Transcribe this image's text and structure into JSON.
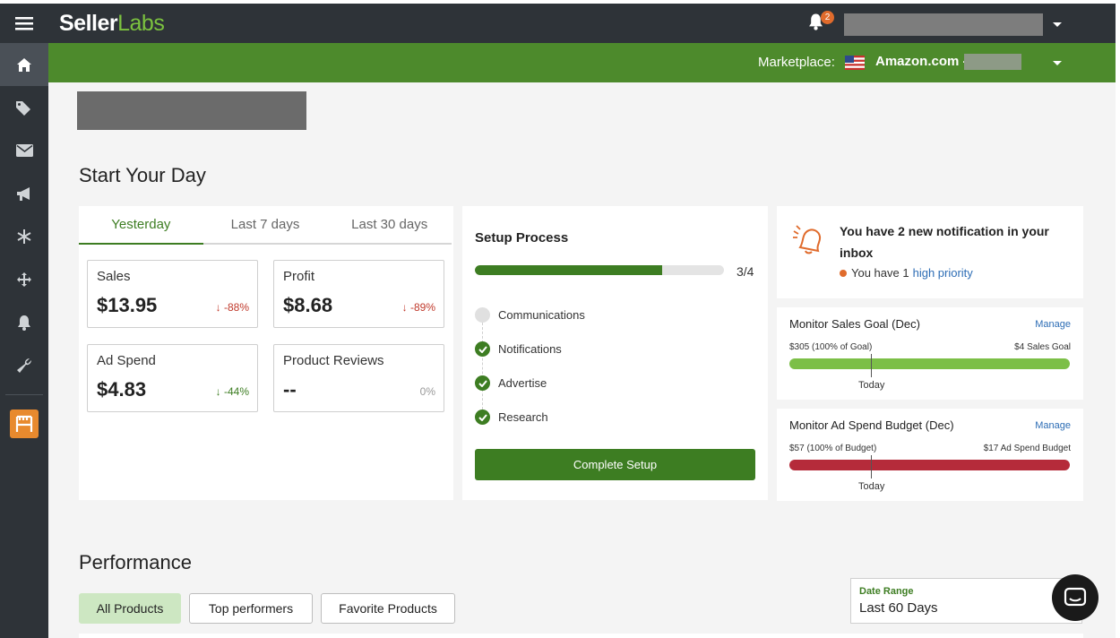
{
  "brand": {
    "name_part1": "Seller",
    "name_part2": "Labs"
  },
  "header": {
    "notification_count": "2",
    "marketplace_label": "Marketplace:",
    "marketplace_name": "Amazon.com -"
  },
  "rail_icons": [
    "home-icon",
    "tag-icon",
    "mail-icon",
    "megaphone-icon",
    "snowflake-icon",
    "move-icon",
    "bell-icon",
    "wrench-icon",
    "storefront-app-icon"
  ],
  "start": {
    "title": "Start Your Day",
    "tabs": [
      "Yesterday",
      "Last 7 days",
      "Last 30 days"
    ],
    "active_tab": "Yesterday",
    "metrics": [
      {
        "label": "Sales",
        "value": "$13.95",
        "change": "-88%"
      },
      {
        "label": "Profit",
        "value": "$8.68",
        "change": "-89%"
      },
      {
        "label": "Ad Spend",
        "value": "$4.83",
        "change": "-44%"
      },
      {
        "label": "Product Reviews",
        "value": "--",
        "change": "0%"
      }
    ]
  },
  "setup": {
    "title": "Setup Process",
    "progress_text": "3/4",
    "progress_fraction": 0.75,
    "steps": [
      {
        "label": "Communications",
        "done": false
      },
      {
        "label": "Notifications",
        "done": true
      },
      {
        "label": "Advertise",
        "done": true
      },
      {
        "label": "Research",
        "done": true
      }
    ],
    "button_label": "Complete Setup"
  },
  "notification": {
    "title": "You have 2 new notification in your inbox",
    "sub_prefix": "You have 1",
    "sub_link": "high priority"
  },
  "sales_goal": {
    "title": "Monitor Sales Goal (Dec)",
    "manage": "Manage",
    "left": "$305 (100% of Goal)",
    "right": "$4 Sales Goal",
    "today": "Today",
    "color": "#7cbf47",
    "fill_fraction": 1.0
  },
  "ad_budget": {
    "title": "Monitor Ad Spend Budget (Dec)",
    "manage": "Manage",
    "left": "$57 (100% of Budget)",
    "right": "$17 Ad Spend Budget",
    "today": "Today",
    "color": "#b52b3a",
    "fill_fraction": 1.0
  },
  "performance": {
    "title": "Performance",
    "filters": [
      "All Products",
      "Top performers",
      "Favorite Products"
    ],
    "date_range_label": "Date Range",
    "date_range_value": "Last 60 Days"
  },
  "colors": {
    "brand_green": "#4d8a2c",
    "dark_green": "#3d7d22",
    "down_red": "#c0392b"
  }
}
